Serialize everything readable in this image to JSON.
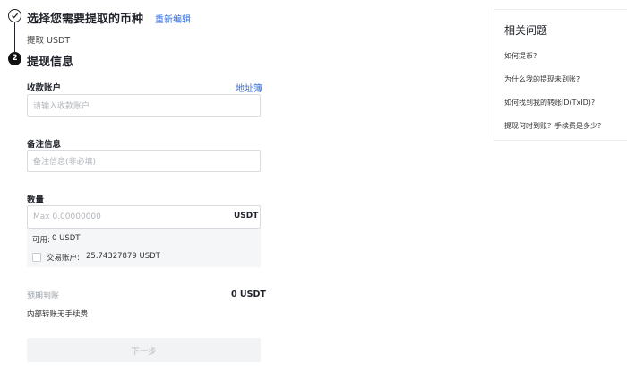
{
  "step1": {
    "title": "选择您需要提取的币种",
    "edit_link": "重新编辑",
    "selected": "提取 USDT"
  },
  "step2": {
    "number": "2",
    "title": "提现信息"
  },
  "form": {
    "account_label": "收款账户",
    "address_book_link": "地址簿",
    "account_placeholder": "请输入收款账户",
    "note_label": "备注信息",
    "note_placeholder": "备注信息(非必填)",
    "amount_label": "数量",
    "amount_placeholder": "Max 0.00000000",
    "amount_unit": "USDT",
    "available_label": "可用:",
    "available_value": "0 USDT",
    "trade_account_label": "交易账户:",
    "trade_account_value": "25.74327879 USDT",
    "expected_label": "预期到账",
    "expected_value": "0 USDT",
    "fee_note": "内部转账无手续费",
    "next_button": "下一步"
  },
  "faq": {
    "title": "相关问题",
    "items": [
      "如何提币?",
      "为什么我的提现未到账?",
      "如何找到我的转账ID(TxID)?",
      "提现何时到账？手续费是多少?"
    ]
  }
}
